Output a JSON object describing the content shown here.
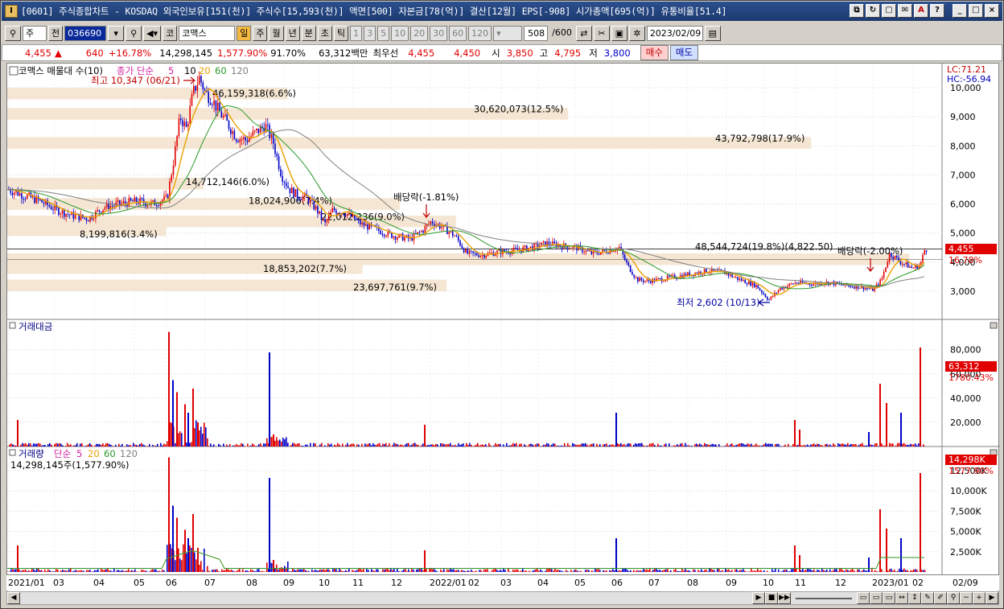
{
  "window": {
    "title": "[0601] 주식종합차트 - KOSDAQ 외국인보유[151(천)] 주식수[15,593(천)] 액면[500] 자본금[78(억)] 결산[12월] EPS[-908] 시가총액[695(억)] 유통비율[51.4]",
    "app_icon": "I"
  },
  "toolbar": {
    "period": "주",
    "prev": "전",
    "code": "036690",
    "market": "코",
    "stock_name": "코맥스",
    "intervals": [
      "일",
      "주",
      "월",
      "년",
      "분",
      "초",
      "틱"
    ],
    "selected_interval": "일",
    "ticks": [
      "1",
      "3",
      "5",
      "10",
      "20",
      "30",
      "60",
      "120"
    ],
    "count": "508",
    "count_total": "/600",
    "date": "2023/02/09"
  },
  "quote": {
    "price": "4,455",
    "change": "640",
    "change_pct": "+16.78%",
    "volume": "14,298,145",
    "volume_pct": "1,577.90%",
    "ratio": "91.70%",
    "amount": "63,312백만",
    "best_label": "최우선",
    "ask": "4,455",
    "bid": "4,450",
    "open_label": "시",
    "open": "3,850",
    "high_label": "고",
    "high": "4,795",
    "low_label": "저",
    "low": "3,800",
    "buy": "매수",
    "sell": "매도"
  },
  "price_panel": {
    "legend_name": "코맥스 매물대 수(10)",
    "legend_ma": "종가 단순",
    "ma": [
      "5",
      "10",
      "20",
      "60",
      "120"
    ],
    "lc": "LC:71.21",
    "hc": "HC:-56.94",
    "y_ticks": [
      "10,000",
      "9,000",
      "8,000",
      "7,000",
      "6,000",
      "5,000",
      "4,000",
      "3,000"
    ],
    "last_price": "4,455",
    "last_pct": "16.78%",
    "high_note": "최고 10,347 (06/21)",
    "low_note": "최저 2,602 (10/13)",
    "div1": "배당락(-1.81%)",
    "div2": "배당락(-2.00%)",
    "profile_labels": [
      "46,159,318(6.6%)",
      "30,620,073(12.5%)",
      "43,792,798(17.9%)",
      "14,712,146(6.0%)",
      "18,024,906(7.4%)",
      "22,012,236(9.0%)",
      "8,199,816(3.4%)",
      "48,544,724(19.8%)(4,822.50)",
      "18,853,202(7.7%)",
      "23,697,761(9.7%)"
    ]
  },
  "amount_panel": {
    "title": "거래대금",
    "y_ticks": [
      "80,000",
      "60,000",
      "40,000",
      "20,000"
    ],
    "last": "63,312",
    "last_pct": "1780.43%"
  },
  "volume_panel": {
    "title": "거래량",
    "ma_label": "단순",
    "ma": [
      "5",
      "20",
      "60",
      "120"
    ],
    "value_label": "14,298,145주(1,577.90%)",
    "y_ticks": [
      "12,500K",
      "10,000K",
      "7,500K",
      "5,000K",
      "2,500K"
    ],
    "last": "14,298K",
    "last_pct": "1577.90%"
  },
  "x_axis": [
    "2021/01",
    "03",
    "04",
    "05",
    "06",
    "07",
    "08",
    "09",
    "10",
    "11",
    "12",
    "2022/01",
    "02",
    "03",
    "04",
    "05",
    "06",
    "07",
    "08",
    "09",
    "10",
    "11",
    "12",
    "2023/01",
    "02"
  ],
  "x_axis_right": "02/09",
  "colors": {
    "up": "#e00000",
    "down": "#0000c8",
    "profile": "#f5e6d3",
    "ma5": "#e8a000",
    "ma20": "#2a9a2a",
    "ma60": "#808080"
  }
}
